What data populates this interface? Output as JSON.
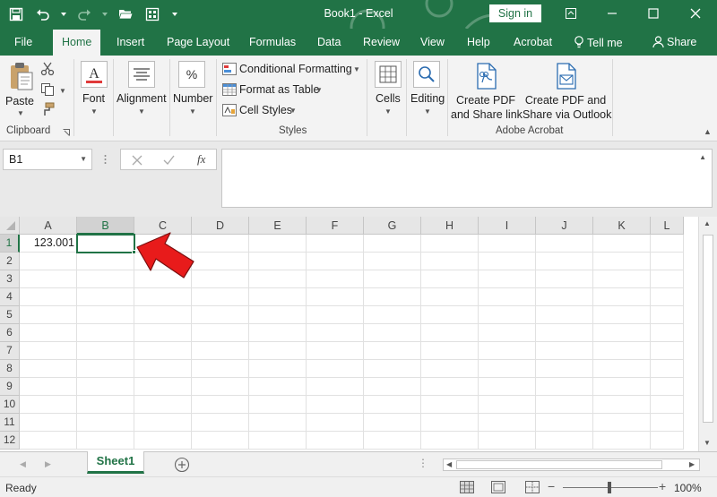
{
  "window": {
    "title": "Book1  -  Excel",
    "signin_label": "Sign in"
  },
  "tabs": [
    "File",
    "Home",
    "Insert",
    "Page Layout",
    "Formulas",
    "Data",
    "Review",
    "View",
    "Help",
    "Acrobat",
    "Tell me",
    "Share"
  ],
  "ribbon": {
    "clipboard": {
      "paste_label": "Paste",
      "group_label": "Clipboard"
    },
    "font_label": "Font",
    "alignment_label": "Alignment",
    "number_label": "Number",
    "styles": {
      "conditional_formatting": "Conditional Formatting",
      "format_as_table": "Format as Table",
      "cell_styles": "Cell Styles",
      "group_label": "Styles"
    },
    "cells_label": "Cells",
    "editing_label": "Editing",
    "acrobat": {
      "create_pdf_share_link": [
        "Create PDF",
        "and Share link"
      ],
      "create_pdf_outlook": [
        "Create PDF and",
        "Share via Outlook"
      ],
      "group_label": "Adobe Acrobat"
    }
  },
  "formula_bar": {
    "name_box": "B1",
    "fx_label": "fx",
    "formula_value": ""
  },
  "grid": {
    "columns": [
      "A",
      "B",
      "C",
      "D",
      "E",
      "F",
      "G",
      "H",
      "I",
      "J",
      "K",
      "L"
    ],
    "rows": [
      "1",
      "2",
      "3",
      "4",
      "5",
      "6",
      "7",
      "8",
      "9",
      "10",
      "11",
      "12"
    ],
    "cell_A1": "123.001",
    "selected_column": "B",
    "selected_row": "1"
  },
  "sheets": {
    "tabs": [
      "Sheet1"
    ],
    "active": "Sheet1",
    "dots": "⋮"
  },
  "status": {
    "ready": "Ready",
    "zoom": "100%"
  },
  "colors": {
    "brand": "#217346",
    "annotation_arrow": "#e81b1b"
  }
}
